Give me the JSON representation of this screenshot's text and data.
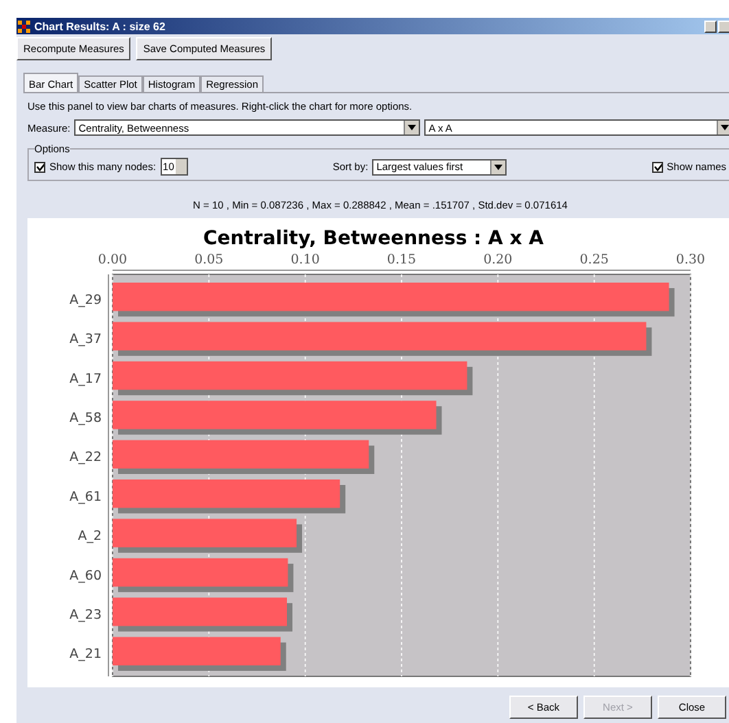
{
  "window": {
    "title": "Chart Results: A : size 62"
  },
  "toolbar": [
    "Recompute Measures",
    "Save Computed Measures"
  ],
  "tabs": [
    {
      "label": "Bar Chart",
      "selected": true
    },
    {
      "label": "Scatter Plot",
      "selected": false
    },
    {
      "label": "Histogram",
      "selected": false
    },
    {
      "label": "Regression",
      "selected": false
    }
  ],
  "description": "Use this panel to view bar charts of measures. Right-click the chart for more options.",
  "measure": {
    "label": "Measure:",
    "value": "Centrality, Betweenness",
    "network": "A x A"
  },
  "options": {
    "legend": "Options",
    "show_nodes": {
      "label": "Show this many nodes:",
      "checked": true,
      "value": "10"
    },
    "sort": {
      "label": "Sort by:",
      "value": "Largest values first"
    },
    "show_names": {
      "label": "Show names",
      "checked": true
    }
  },
  "stats": "N = 10 , Min = 0.087236 , Max = 0.288842 , Mean = .151707 , Std.dev = 0.071614",
  "chart": {
    "chart_data": {
      "type": "bar",
      "orientation": "horizontal",
      "title": "Centrality, Betweenness : A x A",
      "categories": [
        "A_29",
        "A_37",
        "A_17",
        "A_58",
        "A_22",
        "A_61",
        "A_2",
        "A_60",
        "A_23",
        "A_21"
      ],
      "grid": true,
      "series": [
        {
          "color": "#ff5a5f",
          "values": [
            0.2888,
            0.277,
            0.184,
            0.168,
            0.133,
            0.118,
            0.0955,
            0.091,
            0.0905,
            0.0872
          ]
        }
      ],
      "xlim": [
        0,
        0.3
      ],
      "xticks": [
        {
          "value": 0,
          "label": "0.00"
        },
        {
          "value": 0.05,
          "label": "0.05"
        },
        {
          "value": 0.1,
          "label": "0.10"
        },
        {
          "value": 0.15,
          "label": "0.15"
        },
        {
          "value": 0.2,
          "label": "0.20"
        },
        {
          "value": 0.25,
          "label": "0.25"
        },
        {
          "value": 0.3,
          "label": "0.30"
        }
      ]
    }
  },
  "footer": [
    {
      "label": "< Back",
      "disabled": false
    },
    {
      "label": "Next >",
      "disabled": true
    },
    {
      "label": "Close",
      "disabled": false
    }
  ]
}
